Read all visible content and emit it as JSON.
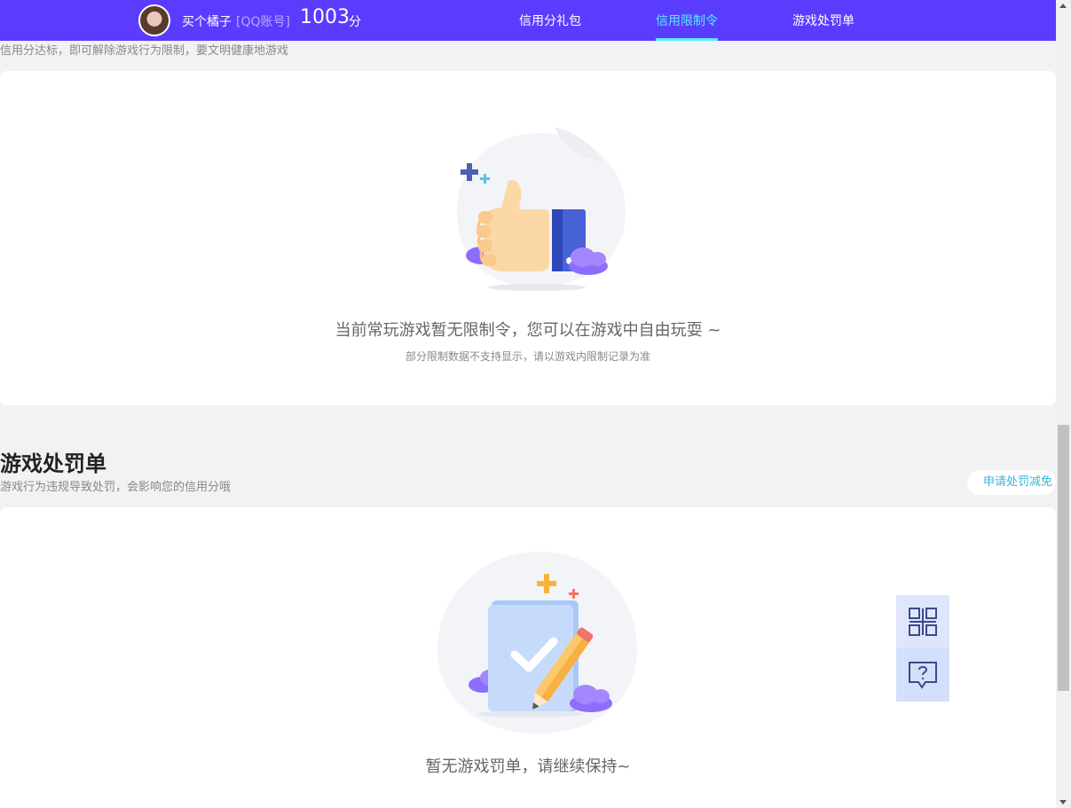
{
  "header": {
    "username": "买个橘子",
    "account_type": "[QQ账号]",
    "score": "1003",
    "score_unit": "分",
    "tabs": [
      {
        "label": "信用分礼包",
        "active": false
      },
      {
        "label": "信用限制令",
        "active": true
      },
      {
        "label": "游戏处罚单",
        "active": false
      }
    ],
    "bg_color": "#5a3cff",
    "active_color": "#5ee9ff"
  },
  "restriction": {
    "subtitle": "信用分达标，即可解除游戏行为限制，要文明健康地游戏",
    "empty_text": "当前常玩游戏暂无限制令，您可以在游戏中自由玩耍 ~",
    "empty_sub": "部分限制数据不支持显示，请以游戏内限制记录为准",
    "illustration": "thumbs-up-icon"
  },
  "penalty": {
    "title": "游戏处罚单",
    "subtitle": "游戏行为违规导致处罚，会影响您的信用分哦",
    "apply_button": "申请处罚减免",
    "empty_text": "暂无游戏罚单，请继续保持~",
    "illustration": "clipboard-check-icon"
  },
  "float_panel": {
    "items": [
      "qr-code-icon",
      "help-chat-icon"
    ]
  }
}
